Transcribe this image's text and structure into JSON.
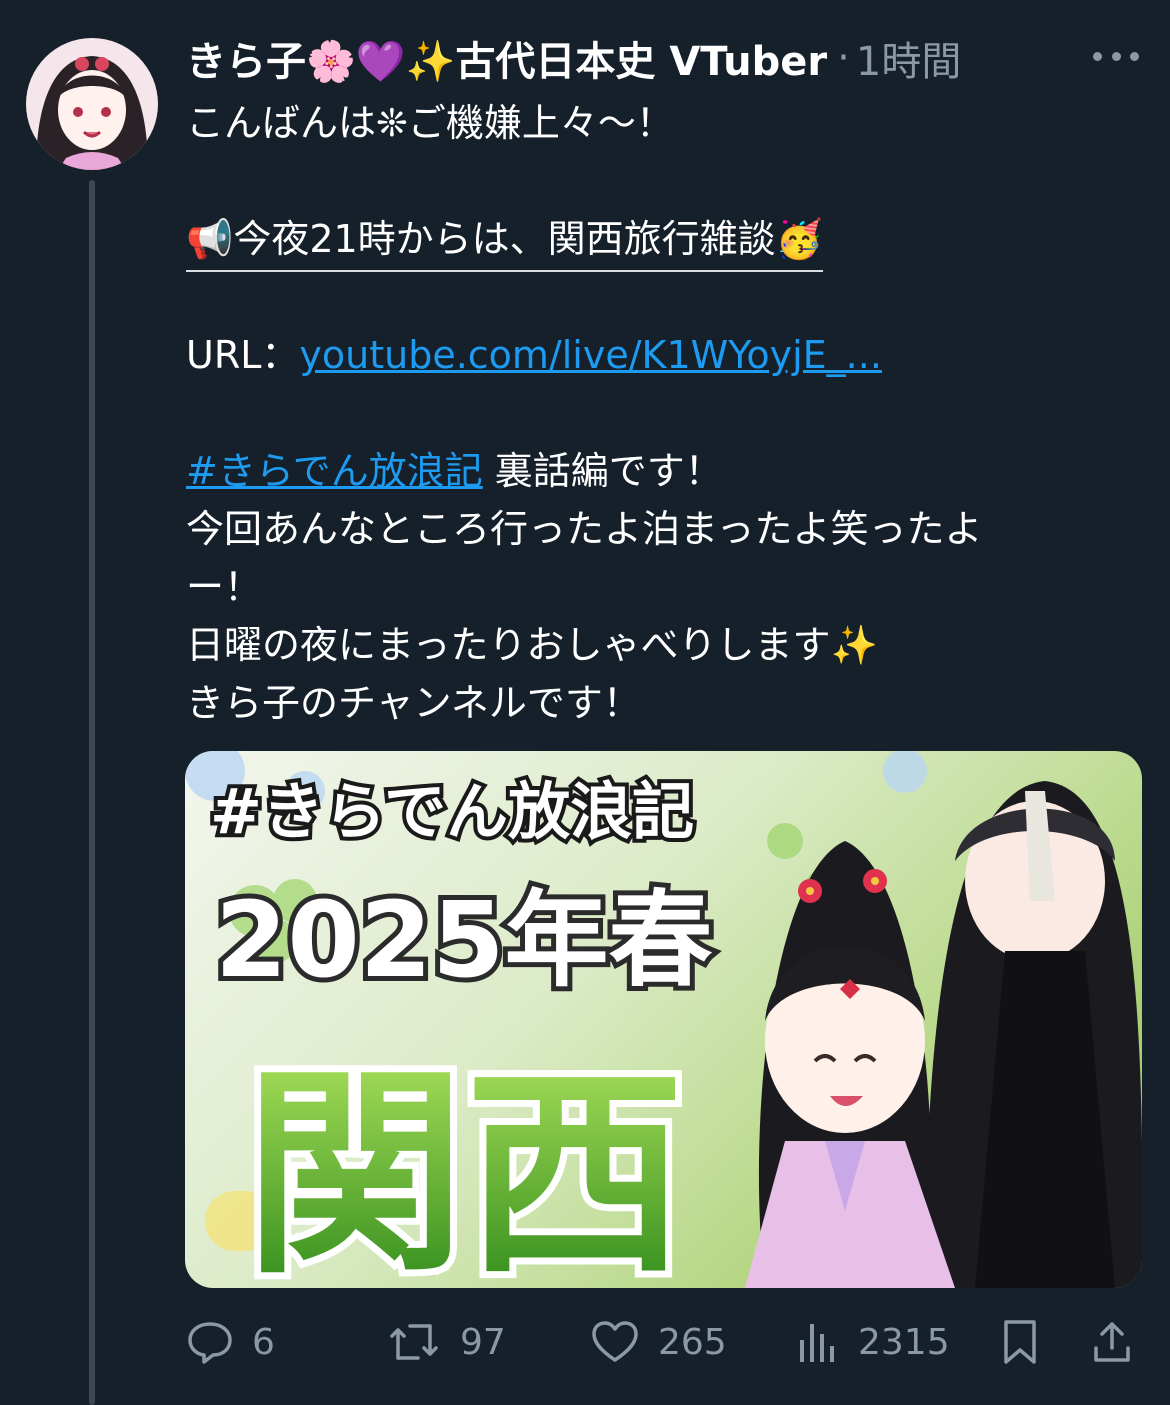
{
  "author": {
    "display_name": "きら子🌸💜✨古代日本史 VTuber",
    "separator": "·",
    "time": "1時間"
  },
  "tweet": {
    "lines": [
      "こんばんは❊ご機嫌上々〜！",
      "",
      "📢今夜21時からは、関西旅行雑談🥳",
      "",
      "URL：",
      "",
      " 裏話編です！",
      "今回あんなところ行ったよ泊まったよ笑ったよ",
      "ー！",
      "日曜の夜にまったりおしゃべりします✨",
      "きら子のチャンネルです！"
    ],
    "url_text": "youtube.com/live/K1WYoyjE_...",
    "hashtag": "#きらでん放浪記"
  },
  "media": {
    "hashtag_title": "#きらでん放浪記",
    "year_title": "2025年春",
    "region_title": "関西"
  },
  "actions": {
    "replies": "6",
    "retweets": "97",
    "likes": "265",
    "views": "2315"
  },
  "icons": [
    "more-icon",
    "reply-icon",
    "retweet-icon",
    "like-icon",
    "views-icon",
    "bookmark-icon",
    "share-icon"
  ],
  "colors": {
    "background": "#15202b",
    "link": "#1d9bf0",
    "muted": "#8b98a5"
  }
}
